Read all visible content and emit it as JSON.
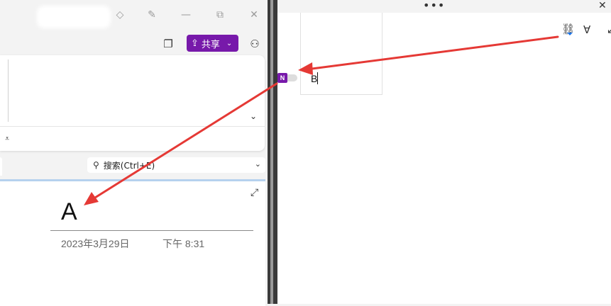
{
  "left_window": {
    "share_label": "共享",
    "search_placeholder": "搜索(Ctrl+E)",
    "page_title": "A",
    "page_date": "2023年3月29日",
    "page_time": "下午 8:31"
  },
  "right_window": {
    "note_text": "B",
    "onenote_badge": "N",
    "menu_dots": "•••"
  },
  "colors": {
    "accent": "#7719aa",
    "arrow": "#e53935",
    "page_tab": "#b5d1ee"
  },
  "icons": [
    "diamond-icon",
    "pen-icon",
    "minimize-icon",
    "restore-icon",
    "close-icon",
    "notebook-icon",
    "share-icon",
    "people-icon",
    "chevron-down-icon",
    "search-icon",
    "expand-icon",
    "link-icon",
    "highlighter-icon",
    "onenote-icon"
  ]
}
